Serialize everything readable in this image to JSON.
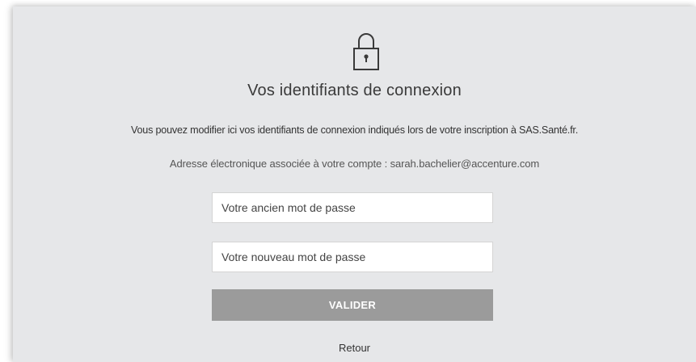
{
  "header": {
    "icon": "lock-icon",
    "title": "Vos identifiants de connexion"
  },
  "description": "Vous pouvez modifier ici vos identifiants de connexion indiqués lors de votre inscription à SAS.Santé.fr.",
  "email_line": "Adresse électronique associée à votre compte : sarah.bachelier@accenture.com",
  "form": {
    "old_password": {
      "value": "",
      "placeholder": "Votre ancien mot de passe"
    },
    "new_password": {
      "value": "",
      "placeholder": "Votre nouveau mot de passe"
    },
    "submit_label": "VALIDER",
    "submit_color": "#9b9b9b"
  },
  "back_link": "Retour",
  "colors": {
    "card_background": "#e6e7e9",
    "text": "#333333"
  }
}
